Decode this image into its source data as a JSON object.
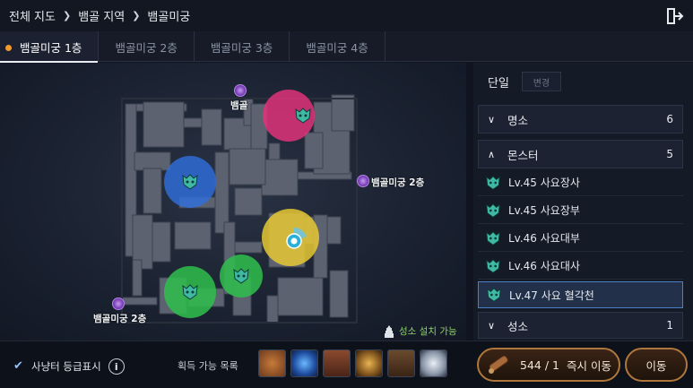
{
  "breadcrumb": {
    "items": [
      "전체 지도",
      "뱀골 지역",
      "뱀골미궁"
    ]
  },
  "tabs": [
    {
      "label": "뱀골미궁 1층",
      "active": true
    },
    {
      "label": "뱀골미궁 2층",
      "active": false
    },
    {
      "label": "뱀골미궁 3층",
      "active": false
    },
    {
      "label": "뱀골미궁 4층",
      "active": false
    }
  ],
  "map": {
    "labels": {
      "top": "뱀골",
      "right": "뱀골미궁 2층",
      "left": "뱀골미궁 2층"
    },
    "sanctuary_label": "성소 설치 가능",
    "zone_colors": {
      "red": "#e0337a",
      "blue": "#2f6fe0",
      "yellow": "#e6c832",
      "green": "#2fbf4c"
    }
  },
  "panel": {
    "mode_label": "단일",
    "change_button": "변경",
    "categories": [
      {
        "label": "명소",
        "count": "6",
        "expanded": false
      },
      {
        "label": "몬스터",
        "count": "5",
        "expanded": true
      },
      {
        "label": "성소",
        "count": "1",
        "expanded": false
      }
    ],
    "monsters": [
      {
        "label": "Lv.45 사요장사",
        "selected": false
      },
      {
        "label": "Lv.45 사요장부",
        "selected": false
      },
      {
        "label": "Lv.46 사요대부",
        "selected": false
      },
      {
        "label": "Lv.46 사요대사",
        "selected": false
      },
      {
        "label": "Lv.47 사요 혈각천",
        "selected": true
      }
    ]
  },
  "bottom": {
    "hunter_grade_label": "사냥터 등급표시",
    "hunter_grade_checked": true,
    "info_glyph": "i",
    "loot_label": "획득 가능 목록",
    "loot_icons": [
      "coin-icon",
      "blue-orb-icon",
      "armor-icon",
      "gold-ring-icon",
      "chest-icon",
      "white-crystal-icon"
    ],
    "teleport_count": "544 / 1",
    "teleport_label": "즉시 이동",
    "move_label": "이동"
  }
}
